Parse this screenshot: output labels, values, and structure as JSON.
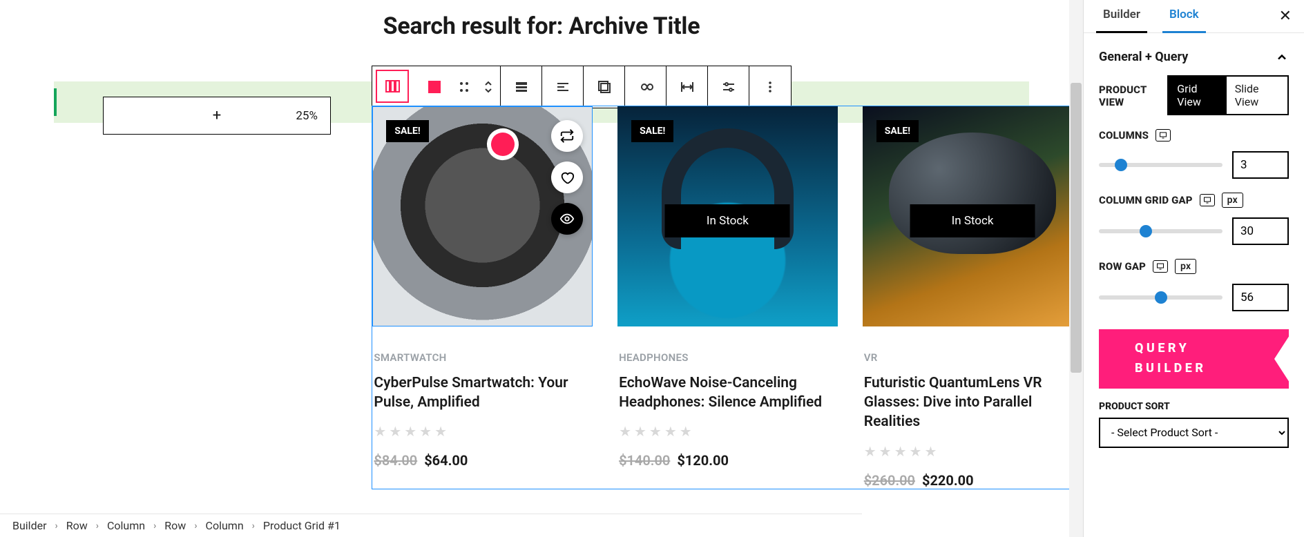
{
  "page": {
    "title": "Search result for: Archive Title"
  },
  "column_slot": {
    "percent": "25%"
  },
  "products": [
    {
      "sale": "SALE!",
      "stock": null,
      "category": "SMARTWATCH",
      "title": "CyberPulse Smartwatch: Your Pulse, Amplified",
      "old_price": "$84.00",
      "price": "$64.00"
    },
    {
      "sale": "SALE!",
      "stock": "In Stock",
      "category": "HEADPHONES",
      "title": "EchoWave Noise-Canceling Headphones: Silence Amplified",
      "old_price": "$140.00",
      "price": "$120.00"
    },
    {
      "sale": "SALE!",
      "stock": "In Stock",
      "category": "VR",
      "title": "Futuristic QuantumLens VR Glasses: Dive into Parallel Realities",
      "old_price": "$260.00",
      "price": "$220.00"
    }
  ],
  "sidebar": {
    "tabs": {
      "builder": "Builder",
      "block": "Block"
    },
    "section": "General + Query",
    "product_view": {
      "label": "PRODUCT VIEW",
      "grid": "Grid View",
      "slide": "Slide View"
    },
    "columns": {
      "label": "COLUMNS",
      "value": "3",
      "knob_pct": 18
    },
    "col_gap": {
      "label": "COLUMN GRID GAP",
      "unit": "px",
      "value": "30",
      "knob_pct": 38
    },
    "row_gap": {
      "label": "ROW GAP",
      "unit": "px",
      "value": "56",
      "knob_pct": 50
    },
    "query_btn": "QUERY BUILDER",
    "sort": {
      "label": "PRODUCT SORT",
      "placeholder": "- Select Product Sort -"
    }
  },
  "breadcrumb": [
    "Builder",
    "Row",
    "Column",
    "Row",
    "Column",
    "Product Grid #1"
  ]
}
